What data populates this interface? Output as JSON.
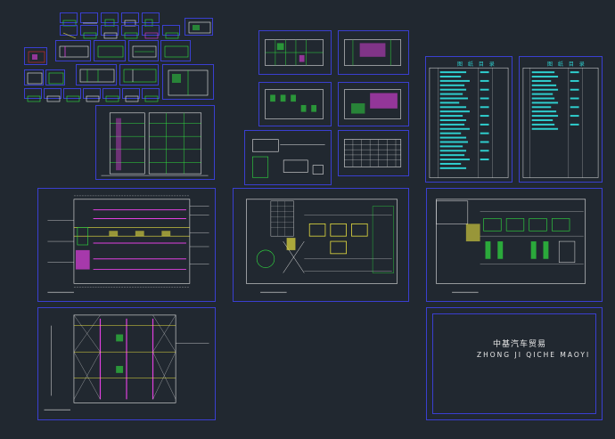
{
  "canvas": {
    "background": "#212830",
    "frame_color": "#3a3fd0"
  },
  "drawing_index": {
    "title_left": "图 纸 目 录",
    "title_right": "图 纸 目 录"
  },
  "project": {
    "name_cn": "中基汽车贸易",
    "name_en": "ZHONG  JI  QICHE  MAOYI"
  },
  "colors": {
    "cyan": "#2fd0d0",
    "magenta": "#e040e0",
    "green": "#30e040",
    "yellow": "#e8e040",
    "red": "#e03030",
    "white": "#e8e8e8"
  }
}
